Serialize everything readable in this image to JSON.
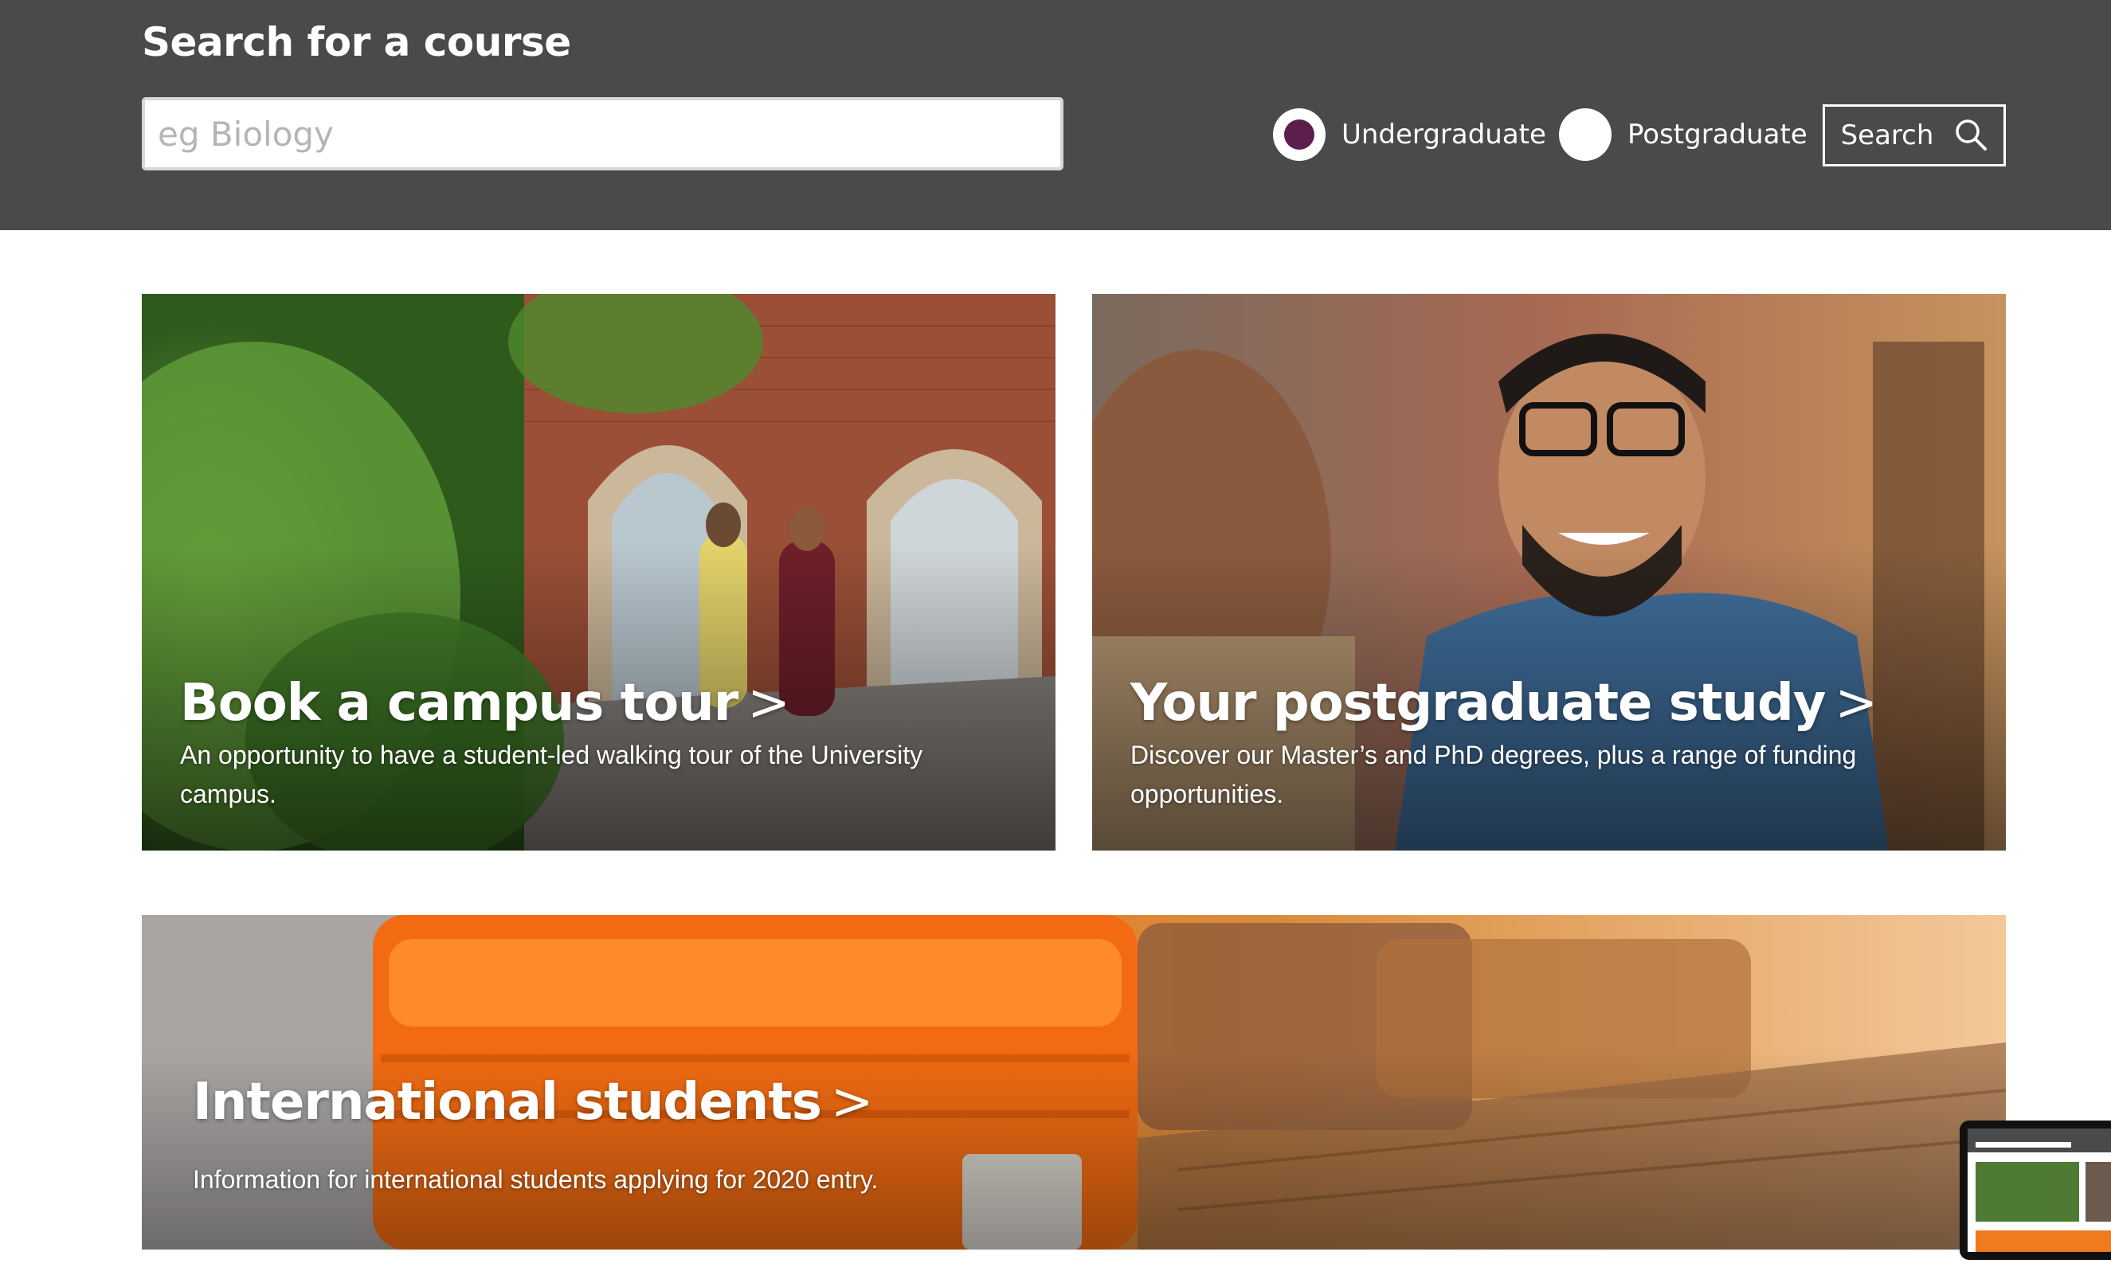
{
  "search": {
    "title": "Search for a course",
    "placeholder": "eg Biology",
    "value": "",
    "options": [
      {
        "label": "Undergraduate",
        "selected": true
      },
      {
        "label": "Postgraduate",
        "selected": false
      }
    ],
    "button_label": "Search",
    "button_icon": "magnifier-icon"
  },
  "cards": [
    {
      "title": "Book a campus tour",
      "description": "An opportunity to have a student-led walking tour of the University campus."
    },
    {
      "title": "Your postgraduate study",
      "description": "Discover our Master’s and PhD degrees, plus a range of funding opportunities."
    },
    {
      "title": "International students",
      "description": "Information for international students applying for 2020 entry."
    }
  ],
  "chevron": ">",
  "colors": {
    "header_bg": "#4a4a4a",
    "radio_selected": "#5c1e4c",
    "card_text": "#ffffff"
  }
}
